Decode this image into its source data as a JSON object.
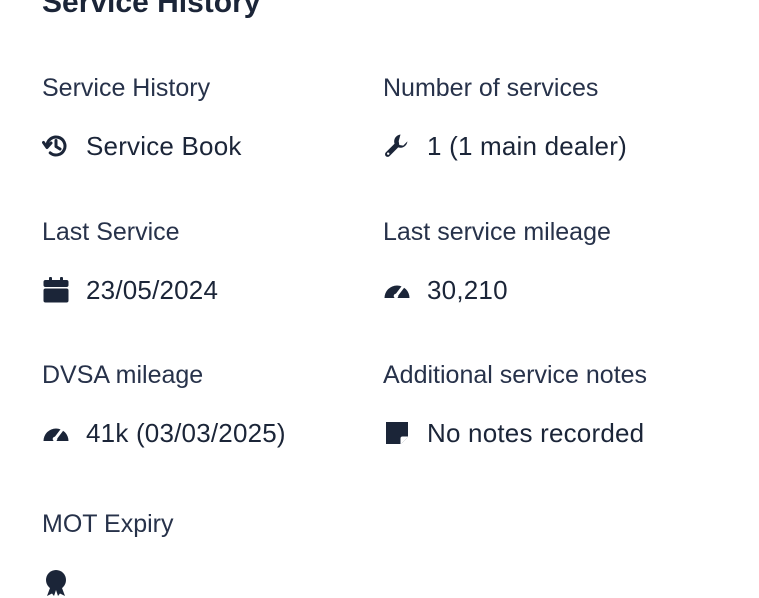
{
  "section": {
    "title": "Service History"
  },
  "fields": {
    "service_history": {
      "label": "Service History",
      "value": "Service Book",
      "icon": "history-icon"
    },
    "number_of_services": {
      "label": "Number of services",
      "value": "1 (1 main dealer)",
      "icon": "wrench-icon"
    },
    "last_service": {
      "label": "Last Service",
      "value": "23/05/2024",
      "icon": "calendar-icon"
    },
    "last_service_mileage": {
      "label": "Last service mileage",
      "value": "30,210",
      "icon": "speedometer-icon"
    },
    "dvsa_mileage": {
      "label": "DVSA mileage",
      "value": "41k (03/03/2025)",
      "icon": "speedometer-icon"
    },
    "additional_service_notes": {
      "label": "Additional service notes",
      "value": "No notes recorded",
      "icon": "note-icon"
    },
    "mot_expiry": {
      "label": "MOT Expiry",
      "icon": "certificate-icon"
    }
  },
  "colors": {
    "text": "#1b2538",
    "label": "#27324a",
    "background": "#ffffff"
  }
}
